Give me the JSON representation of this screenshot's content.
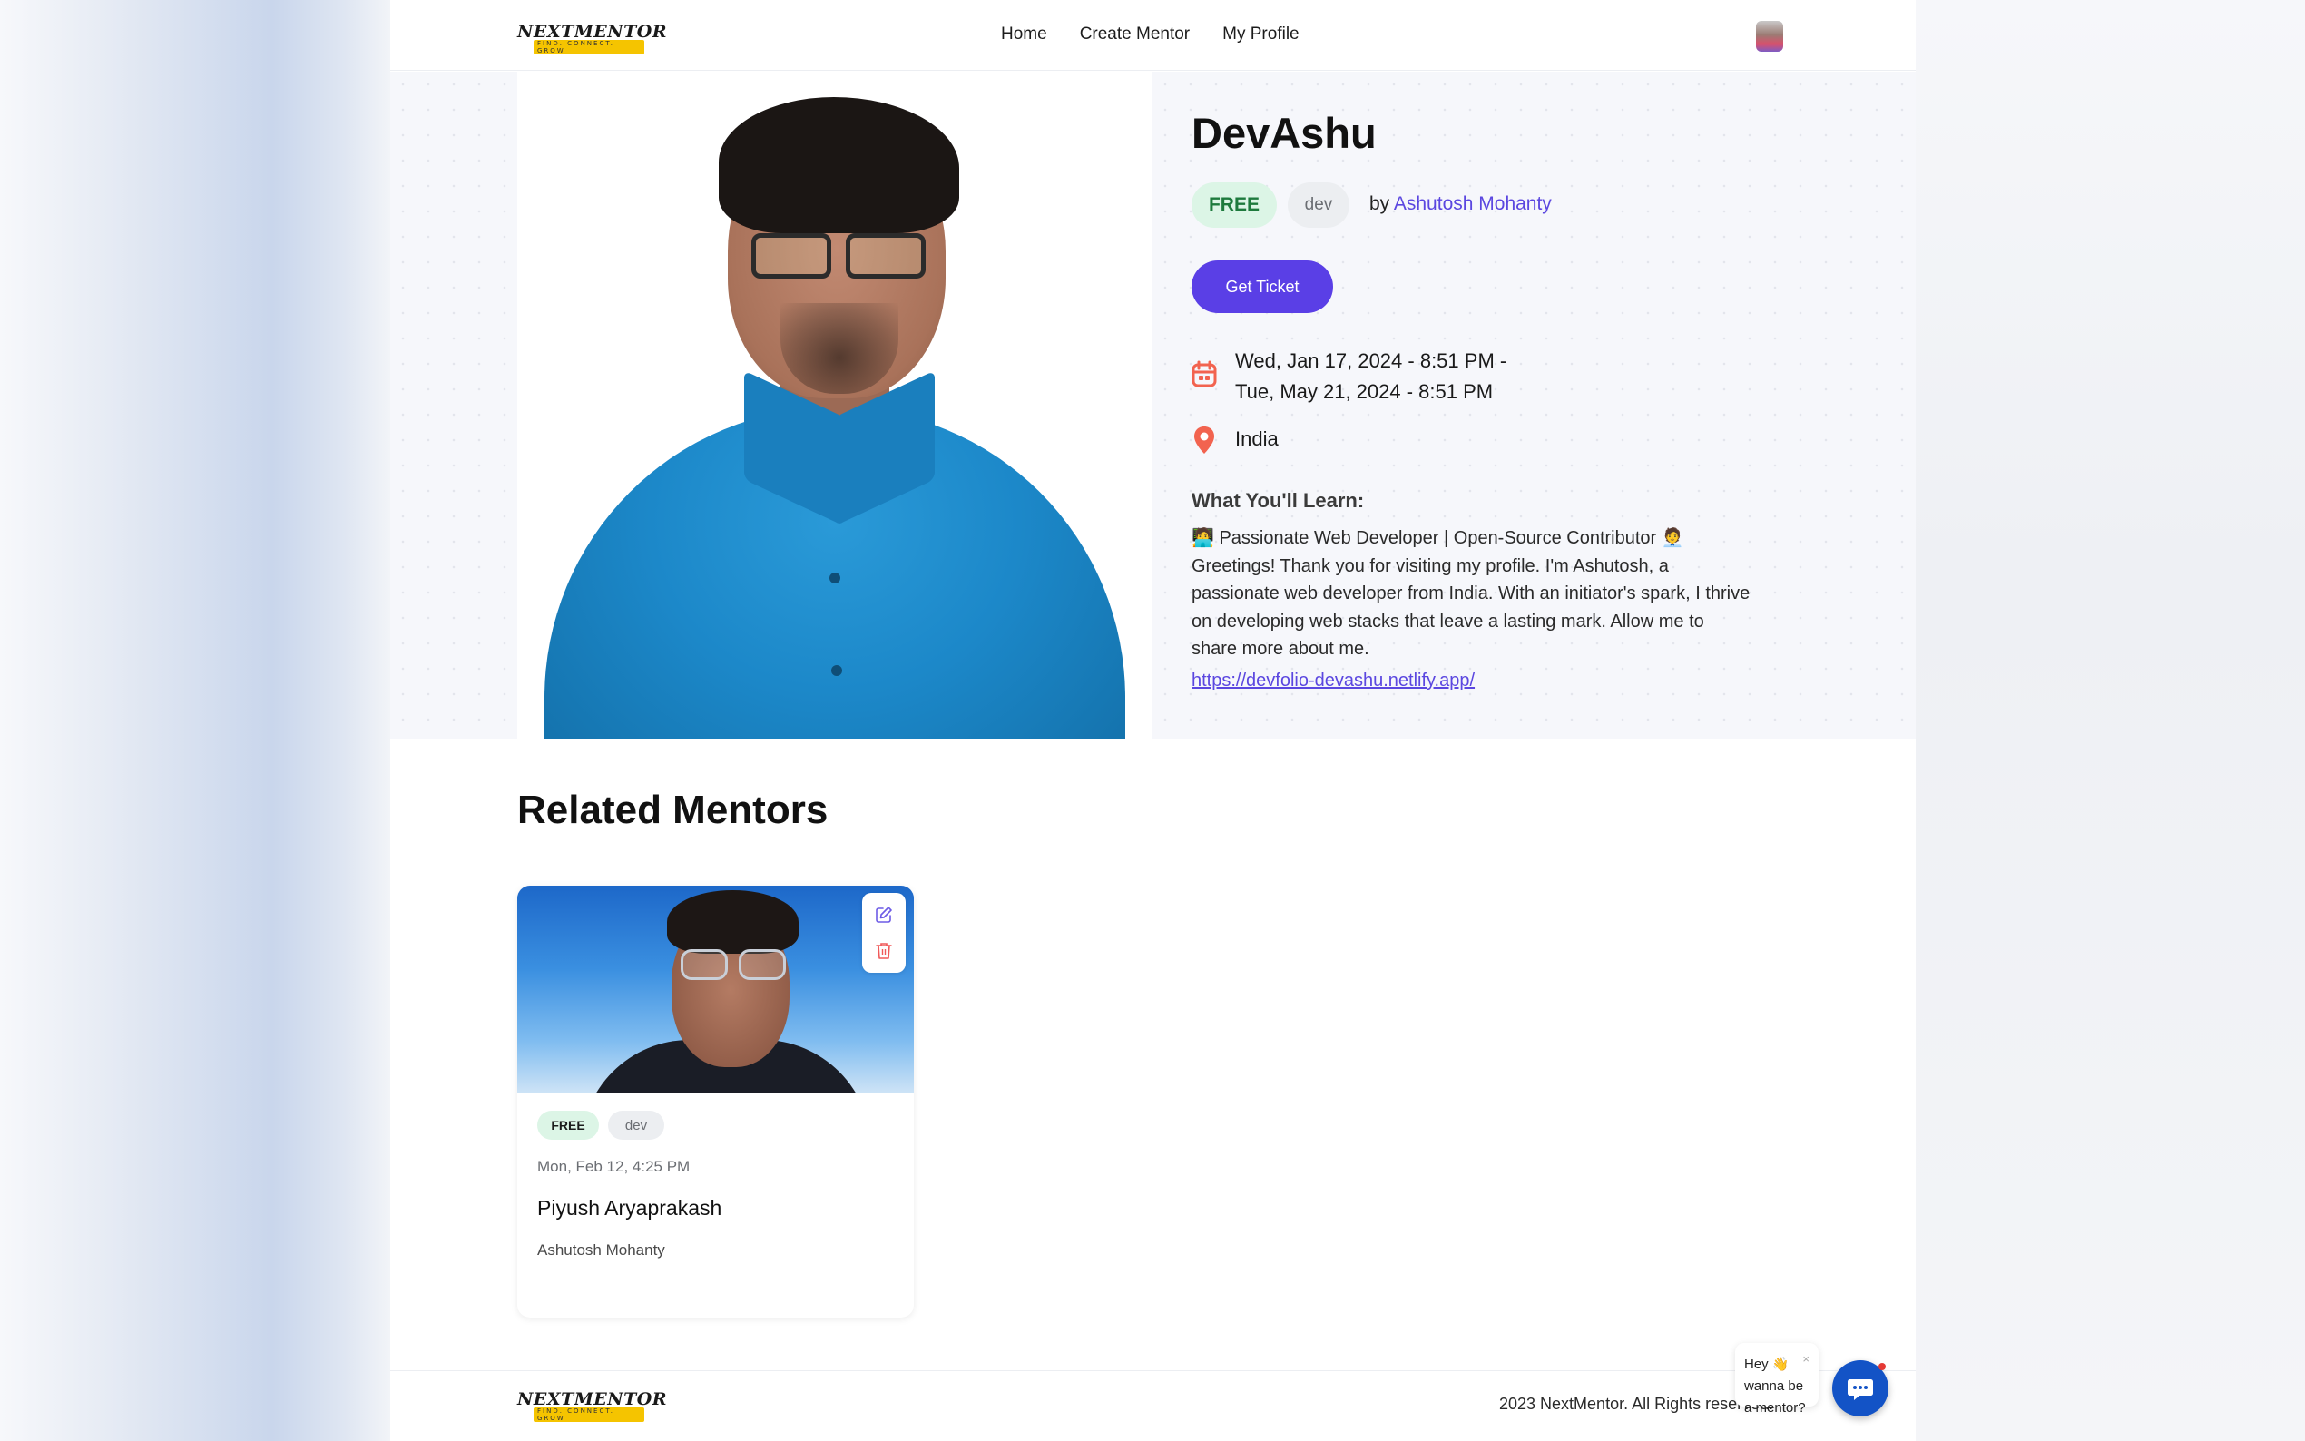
{
  "header": {
    "logo_text": "NEXTMENTOR",
    "logo_tagline": "FIND. CONNECT. GROW",
    "nav": [
      "Home",
      "Create Mentor",
      "My Profile"
    ]
  },
  "event": {
    "title": "DevAshu",
    "price_badge": "FREE",
    "category": "dev",
    "by_prefix": "by",
    "author": "Ashutosh Mohanty",
    "cta": "Get Ticket",
    "date_line1": "Wed, Jan 17, 2024 - 8:51 PM -",
    "date_line2": "Tue, May 21, 2024 - 8:51 PM",
    "location": "India",
    "learn_heading": "What You'll Learn:",
    "description": "🧑‍💻 Passionate Web Developer | Open-Source Contributor 🧑‍💼 Greetings! Thank you for visiting my profile. I'm Ashutosh, a passionate web developer from India. With an initiator's spark, I thrive on developing web stacks that leave a lasting mark. Allow me to share more about me.",
    "link": "https://devfolio-devashu.netlify.app/"
  },
  "related": {
    "heading": "Related Mentors",
    "cards": [
      {
        "price": "FREE",
        "category": "dev",
        "date": "Mon, Feb 12, 4:25 PM",
        "name": "Piyush Aryaprakash",
        "organizer": "Ashutosh Mohanty"
      }
    ]
  },
  "footer": {
    "copyright": "2023 NextMentor. All Rights reserved."
  },
  "chat": {
    "greeting": "Hey 👋 wanna be a mentor?",
    "close": "×"
  },
  "colors": {
    "accent": "#5a3fe6",
    "free_badge_bg": "#dcf5e6",
    "link": "#5b47e0",
    "chat_button": "#1353c6"
  }
}
